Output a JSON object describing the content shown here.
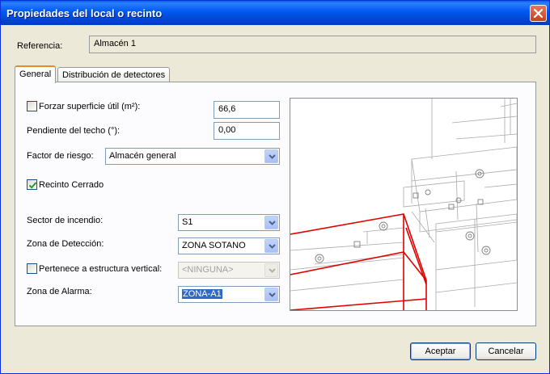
{
  "window": {
    "title": "Propiedades del local o recinto"
  },
  "referencia": {
    "label": "Referencia:",
    "value": "Almacén 1"
  },
  "tabs": [
    {
      "label": "General",
      "active": true
    },
    {
      "label": "Distribución de detectores",
      "active": false
    }
  ],
  "general": {
    "forzar_superficie": {
      "label": "Forzar superficie útil (m²):",
      "checked": false,
      "value": "66,6"
    },
    "pendiente_techo": {
      "label": "Pendiente del techo (°):",
      "value": "0,00"
    },
    "factor_riesgo": {
      "label": "Factor de riesgo:",
      "value": "Almacén general"
    },
    "recinto_cerrado": {
      "label": "Recinto Cerrado",
      "checked": true
    },
    "sector_incendio": {
      "label": "Sector de incendio:",
      "value": "S1"
    },
    "zona_deteccion": {
      "label": "Zona de Detección:",
      "value": "ZONA SOTANO"
    },
    "estructura_vertical": {
      "label": "Pertenece a estructura vertical:",
      "checked": false,
      "value": "<NINGUNA>"
    },
    "zona_alarma": {
      "label": "Zona de Alarma:",
      "value": "ZONA-A1"
    }
  },
  "buttons": {
    "accept": "Aceptar",
    "cancel": "Cancelar"
  },
  "colors": {
    "title_bar": "#0058ee",
    "highlight_room": "#e00000",
    "selection": "#316ac5"
  }
}
